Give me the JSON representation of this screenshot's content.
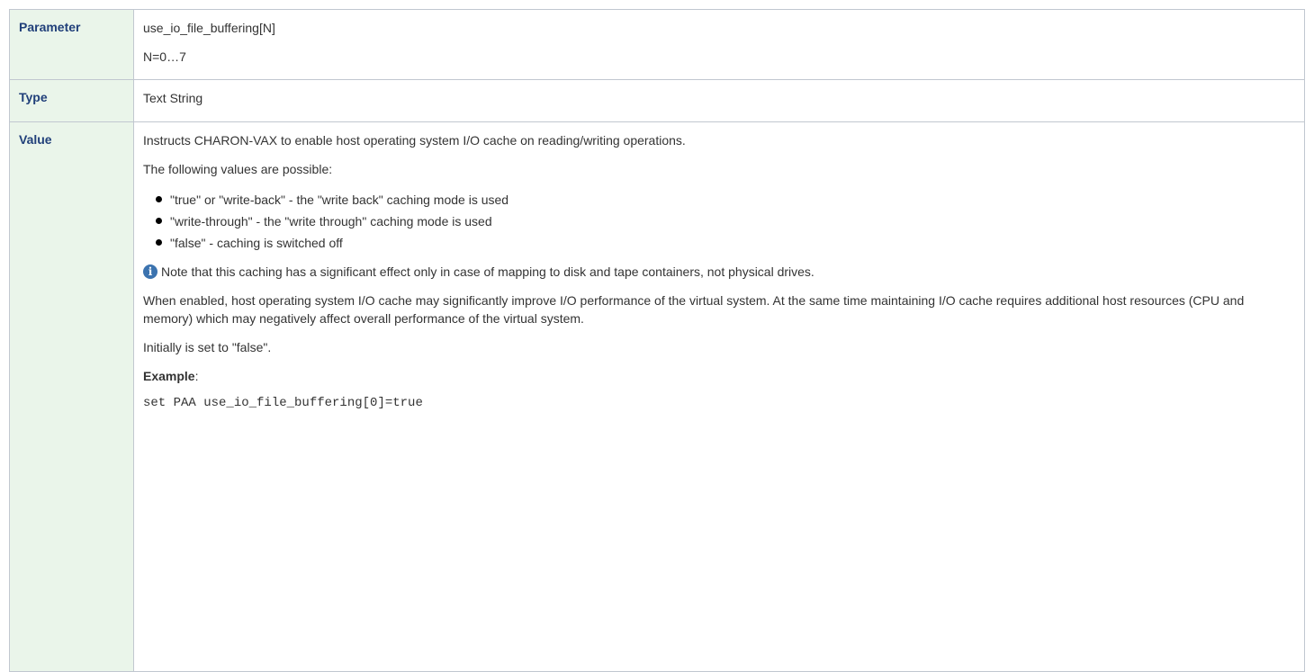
{
  "table": {
    "parameter": {
      "label": "Parameter",
      "name": "use_io_file_buffering[N]",
      "range": "N=0…7"
    },
    "type": {
      "label": "Type",
      "value": "Text String"
    },
    "value": {
      "label": "Value",
      "intro": "Instructs CHARON-VAX to enable host operating system I/O cache on reading/writing operations.",
      "possible_intro": "The following values are possible:",
      "options": [
        "\"true\" or \"write-back\" - the \"write back\" caching mode is used",
        "\"write-through\" - the \"write through\" caching mode is used",
        "\"false\" - caching is switched off"
      ],
      "note_icon": "info-icon",
      "note": "Note that this caching has a significant effect only in case of mapping to disk and tape containers, not physical drives.",
      "description": "When enabled, host operating system I/O cache may significantly improve I/O performance of the virtual system. At the same time maintaining I/O cache requires additional host resources (CPU and memory) which may negatively affect overall performance of the virtual system.",
      "initial": "Initially is set to \"false\".",
      "example_label": "Example",
      "example_suffix": ":",
      "example_code": "set PAA use_io_file_buffering[0]=true"
    }
  }
}
